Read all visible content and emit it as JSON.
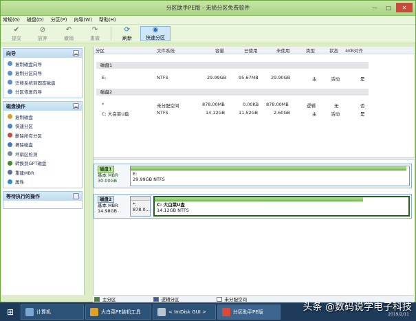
{
  "window": {
    "title": "分区助手PE版 - 无损分区免费软件",
    "min": "—",
    "max": "□",
    "close": "✕"
  },
  "menu": [
    "常规(G)",
    "磁盘(D)",
    "分区(P)",
    "向导(W)",
    "帮助(H)"
  ],
  "toolbar": [
    {
      "label": "提交",
      "icon": "check-icon"
    },
    {
      "label": "放弃",
      "icon": "discard-icon"
    },
    {
      "label": "撤销",
      "icon": "undo-icon"
    },
    {
      "label": "重做",
      "icon": "redo-icon"
    },
    {
      "label": "刷新",
      "icon": "refresh-icon"
    },
    {
      "label": "快速分区",
      "icon": "quick-partition-icon"
    }
  ],
  "wizard_panel": {
    "title": "向导",
    "items": [
      "复制磁盘向导",
      "复制分区向导",
      "迁移系统到固态磁盘",
      "分区恢复向导"
    ]
  },
  "disk_ops_panel": {
    "title": "磁盘操作",
    "items": [
      "复制磁盘",
      "快速分区",
      "删除所有分区",
      "擦除磁盘",
      "坏扇区检测",
      "转换到GPT磁盘",
      "重建MBR",
      "属性"
    ]
  },
  "pending_panel": {
    "title": "等待执行的操作"
  },
  "table": {
    "columns": [
      "分区",
      "文件系统",
      "容量",
      "已使用",
      "未使用",
      "类型",
      "状态",
      "4KB对齐"
    ],
    "disk1": {
      "header": "磁盘1",
      "rows": [
        {
          "partition": "E:",
          "fs": "NTFS",
          "capacity": "29.99GB",
          "used": "95.67MB",
          "unused": "29.90GB",
          "type": "主",
          "status": "活动",
          "align": "是"
        }
      ]
    },
    "disk2": {
      "header": "磁盘2",
      "rows": [
        {
          "partition": "*",
          "fs": "未分配空间",
          "capacity": "878.00MB",
          "used": "0.00KB",
          "unused": "878.00MB",
          "type": "逻辑",
          "status": "无",
          "align": "否"
        },
        {
          "partition": "C: 大白菜U盘",
          "fs": "NTFS",
          "capacity": "14.12GB",
          "used": "11.52GB",
          "unused": "2.60GB",
          "type": "主",
          "status": "活动",
          "align": "是"
        }
      ]
    }
  },
  "diskmap": {
    "disk1": {
      "name": "磁盘1",
      "type": "基本 MBR",
      "size": "30.00GB",
      "part_label": "E:",
      "part_info": "29.99GB NTFS",
      "used_fraction": 0.99
    },
    "disk2": {
      "name": "磁盘2",
      "type": "基本 MBR",
      "size": "14.98GB",
      "unalloc": "*:",
      "unalloc_size": "878.0...",
      "part_label": "C: 大白菜U盘",
      "part_info": "14.12GB NTFS",
      "used_fraction": 0.82
    }
  },
  "legend": [
    {
      "label": "主分区",
      "color": "#3c8c2a"
    },
    {
      "label": "逻辑分区",
      "color": "#3a5bb0"
    },
    {
      "label": "未分配空间",
      "color": "#ffffff"
    }
  ],
  "taskbar": {
    "items": [
      "计算机",
      "大白菜PE装机工具",
      "< ImDisk GUI >",
      "分区助手PE版"
    ],
    "watermark": "头条 @数码说学电子科技",
    "date": "2019/2/11"
  },
  "colors": {
    "accent": "#7cc35a",
    "title_bg": "#b9df92",
    "selection": "#cfe6f7"
  }
}
